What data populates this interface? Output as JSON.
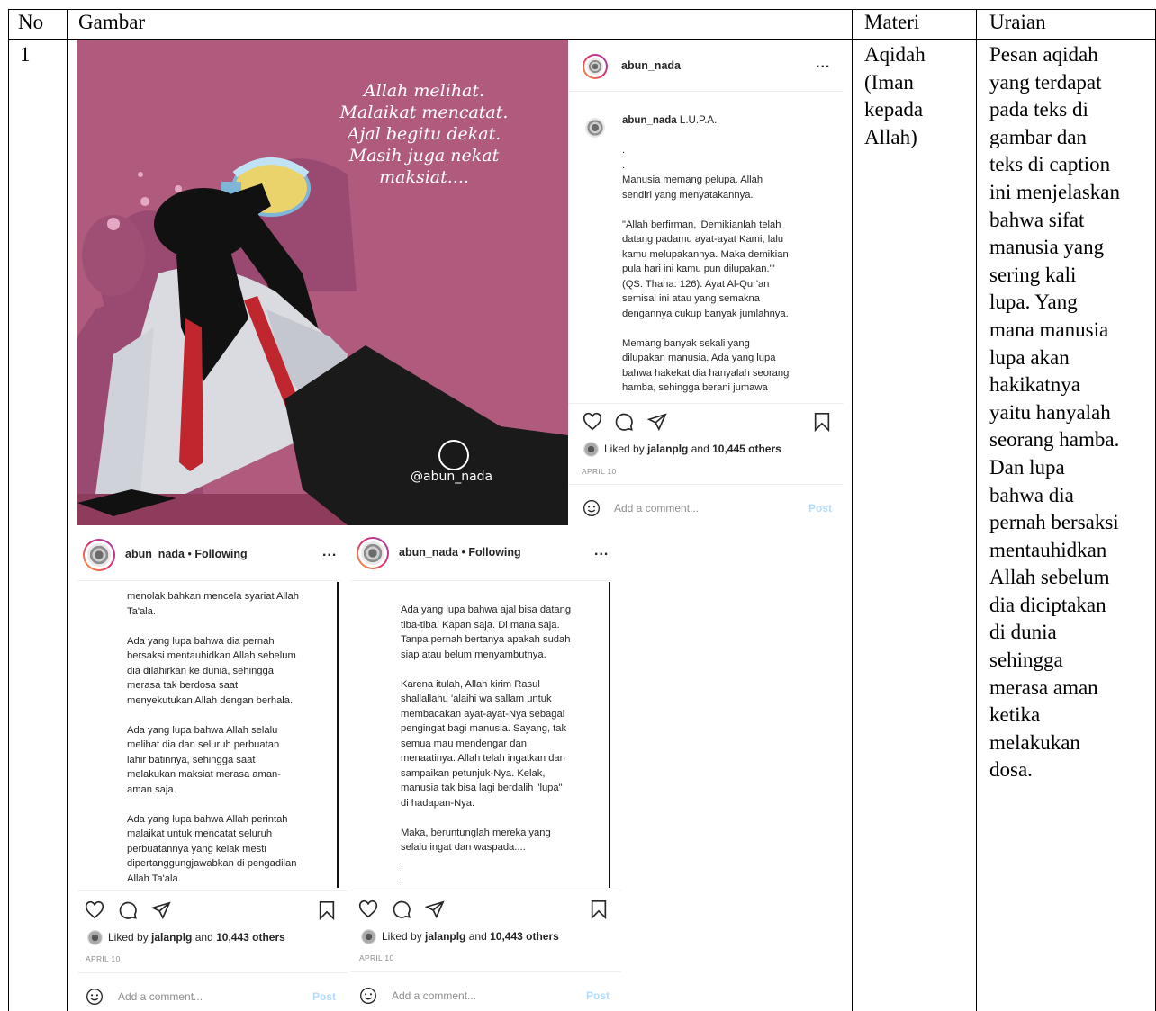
{
  "table": {
    "headers": {
      "no": "No",
      "gambar": "Gambar",
      "materi": "Materi",
      "uraian": "Uraian"
    },
    "row": {
      "no": "1",
      "materi_lines": [
        "Aqidah",
        "(Iman",
        "kepada",
        "Allah)"
      ],
      "uraian_lines": [
        "Pesan aqidah",
        "yang terdapat",
        "pada teks di",
        "gambar dan",
        "teks di caption",
        "ini menjelaskan",
        "bahwa sifat",
        "manusia yang",
        "sering kali",
        "lupa. Yang",
        "mana manusia",
        "lupa akan",
        "hakikatnya",
        "yaitu hanyalah",
        "seorang hamba.",
        "Dan lupa",
        "bahwa dia",
        "pernah bersaksi",
        "mentauhidkan",
        "Allah sebelum",
        "dia diciptakan",
        "di dunia",
        "sehingga",
        "merasa aman",
        "ketika",
        "melakukan",
        "dosa."
      ]
    }
  },
  "illustration": {
    "text_lines": [
      "Allah melihat.",
      "Malaikat mencatat.",
      "Ajal begitu dekat.",
      "Masih juga nekat",
      "maksiat...."
    ],
    "signature": "@abun_nada",
    "colors": {
      "background": "#b05a7e",
      "floor": "#8f3c5c",
      "shirt": "#d9dbe0",
      "tie": "#c0262e"
    }
  },
  "post_main": {
    "username": "abun_nada",
    "more": "...",
    "caption_user": "abun_nada",
    "caption_title": "L.U.P.A.",
    "caption": ".\n.\nManusia memang pelupa. Allah\nsendiri yang menyatakannya.\n\n\"Allah berfirman, 'Demikianlah telah\ndatang padamu ayat-ayat Kami, lalu\nkamu melupakannya. Maka demikian\npula hari ini kamu pun dilupakan.'\"\n(QS. Thaha: 126). Ayat Al-Qur'an\nsemisal ini atau yang semakna\ndengannya cukup banyak jumlahnya.\n\nMemang banyak sekali yang\ndilupakan manusia. Ada yang lupa\nbahwa hakekat dia hanyalah seorang\nhamba, sehingga berani jumawa",
    "liked_prefix": "Liked by",
    "liked_user": "jalanplg",
    "liked_and": "and",
    "liked_count": "10,445 others",
    "date": "APRIL 10",
    "add_comment": "Add a comment...",
    "post_label": "Post"
  },
  "post_left": {
    "username": "abun_nada",
    "following": "Following",
    "more": "...",
    "caption": "menolak bahkan mencela syariat Allah\nTa'ala.\n\nAda yang lupa bahwa dia pernah\nbersaksi mentauhidkan Allah sebelum\ndia dilahirkan ke dunia, sehingga\nmerasa tak berdosa saat\nmenyekutukan Allah dengan berhala.\n\nAda yang lupa bahwa Allah selalu\nmelihat dia dan seluruh perbuatan\nlahir batinnya, sehingga saat\nmelakukan maksiat merasa aman-\naman saja.\n\nAda yang lupa bahwa Allah perintah\nmalaikat untuk mencatat seluruh\nperbuatannya yang kelak mesti\ndipertanggungjawabkan di pengadilan\nAllah Ta'ala.",
    "liked_prefix": "Liked by",
    "liked_user": "jalanplg",
    "liked_and": "and",
    "liked_count": "10,443 others",
    "date": "APRIL 10",
    "add_comment": "Add a comment...",
    "post_label": "Post"
  },
  "post_right": {
    "username": "abun_nada",
    "following": "Following",
    "more": "...",
    "caption": "Ada yang lupa bahwa ajal bisa datang\ntiba-tiba. Kapan saja. Di mana saja.\nTanpa pernah bertanya apakah sudah\nsiap atau belum menyambutnya.\n\nKarena itulah, Allah kirim Rasul\nshallallahu 'alaihi wa sallam untuk\nmembacakan ayat-ayat-Nya sebagai\npengingat bagi manusia. Sayang, tak\nsemua mau mendengar dan\nmenaatinya. Allah telah ingatkan dan\nsampaikan petunjuk-Nya. Kelak,\nmanusia tak bisa lagi berdalih \"lupa\"\ndi hadapan-Nya.\n\nMaka, beruntunglah mereka yang\nselalu ingat dan waspada....\n.\n.",
    "liked_prefix": "Liked by",
    "liked_user": "jalanplg",
    "liked_and": "and",
    "liked_count": "10,443 others",
    "date": "APRIL 10",
    "add_comment": "Add a comment...",
    "post_label": "Post"
  },
  "icons": [
    "heart-icon",
    "comment-icon",
    "share-icon",
    "bookmark-icon",
    "emoji-icon",
    "more-icon"
  ]
}
